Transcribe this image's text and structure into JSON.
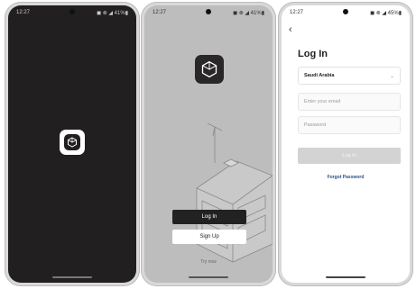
{
  "status_bar": {
    "time": "12:27",
    "left_icons": "▲ ♪ •",
    "right_icons_p1": "◼ ⊗ ◢ 41%▮",
    "right_icons_p2": "◼ ⊗ ◢ 41%▮",
    "right_icons_p3": "◼ ⊗ ◢ 45%▮"
  },
  "welcome": {
    "login_label": "Log In",
    "signup_label": "Sign Up",
    "try_now": "Try now"
  },
  "login": {
    "back_symbol": "‹",
    "title": "Log In",
    "country": "Saudi Arabia",
    "email_placeholder": "Enter your email",
    "password_placeholder": "Password",
    "login_button": "Log In",
    "forgot_password": "Forgot Password"
  },
  "colors": {
    "dark": "#221f20",
    "link": "#2b4f8a"
  },
  "icons": {
    "app_logo": "cube-logo-icon",
    "back": "chevron-left-icon",
    "dropdown": "chevron-down-icon"
  }
}
